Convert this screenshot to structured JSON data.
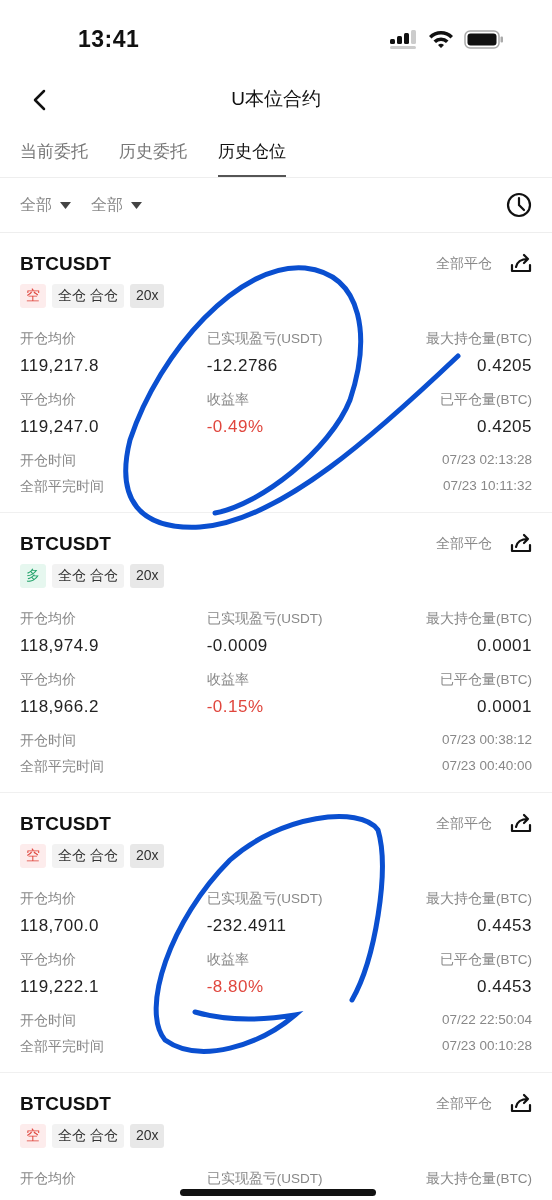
{
  "status_bar": {
    "time": "13:41"
  },
  "header": {
    "title": "U本位合约"
  },
  "tabs": [
    {
      "label": "当前委托",
      "selected": false
    },
    {
      "label": "历史委托",
      "selected": false
    },
    {
      "label": "历史仓位",
      "selected": true
    }
  ],
  "filters": [
    {
      "label": "全部"
    },
    {
      "label": "全部"
    }
  ],
  "positions": [
    {
      "symbol": "BTCUSDT",
      "action": "全部平仓",
      "side": {
        "label": "空",
        "kind": "short"
      },
      "mode": "全仓 合仓",
      "leverage": "20x",
      "fields": [
        {
          "label": "开仓均价",
          "value": "119,217.8",
          "loss": false
        },
        {
          "label": "已实现盈亏(USDT)",
          "value": "-12.2786",
          "loss": false
        },
        {
          "label": "最大持仓量(BTC)",
          "value": "0.4205",
          "loss": false
        },
        {
          "label": "平仓均价",
          "value": "119,247.0",
          "loss": false
        },
        {
          "label": "收益率",
          "value": "-0.49%",
          "loss": true
        },
        {
          "label": "已平仓量(BTC)",
          "value": "0.4205",
          "loss": false
        }
      ],
      "times": [
        {
          "label": "开仓时间",
          "value": "07/23 02:13:28"
        },
        {
          "label": "全部平完时间",
          "value": "07/23 10:11:32"
        }
      ]
    },
    {
      "symbol": "BTCUSDT",
      "action": "全部平仓",
      "side": {
        "label": "多",
        "kind": "long"
      },
      "mode": "全仓 合仓",
      "leverage": "20x",
      "fields": [
        {
          "label": "开仓均价",
          "value": "118,974.9",
          "loss": false
        },
        {
          "label": "已实现盈亏(USDT)",
          "value": "-0.0009",
          "loss": false
        },
        {
          "label": "最大持仓量(BTC)",
          "value": "0.0001",
          "loss": false
        },
        {
          "label": "平仓均价",
          "value": "118,966.2",
          "loss": false
        },
        {
          "label": "收益率",
          "value": "-0.15%",
          "loss": true
        },
        {
          "label": "已平仓量(BTC)",
          "value": "0.0001",
          "loss": false
        }
      ],
      "times": [
        {
          "label": "开仓时间",
          "value": "07/23 00:38:12"
        },
        {
          "label": "全部平完时间",
          "value": "07/23 00:40:00"
        }
      ]
    },
    {
      "symbol": "BTCUSDT",
      "action": "全部平仓",
      "side": {
        "label": "空",
        "kind": "short"
      },
      "mode": "全仓 合仓",
      "leverage": "20x",
      "fields": [
        {
          "label": "开仓均价",
          "value": "118,700.0",
          "loss": false
        },
        {
          "label": "已实现盈亏(USDT)",
          "value": "-232.4911",
          "loss": false
        },
        {
          "label": "最大持仓量(BTC)",
          "value": "0.4453",
          "loss": false
        },
        {
          "label": "平仓均价",
          "value": "119,222.1",
          "loss": false
        },
        {
          "label": "收益率",
          "value": "-8.80%",
          "loss": true
        },
        {
          "label": "已平仓量(BTC)",
          "value": "0.4453",
          "loss": false
        }
      ],
      "times": [
        {
          "label": "开仓时间",
          "value": "07/22 22:50:04"
        },
        {
          "label": "全部平完时间",
          "value": "07/23 00:10:28"
        }
      ]
    },
    {
      "symbol": "BTCUSDT",
      "action": "全部平仓",
      "side": {
        "label": "空",
        "kind": "short"
      },
      "mode": "全仓 合仓",
      "leverage": "20x",
      "fields": [
        {
          "label": "开仓均价"
        },
        {
          "label": "已实现盈亏(USDT)"
        },
        {
          "label": "最大持仓量(BTC)"
        }
      ]
    }
  ]
}
